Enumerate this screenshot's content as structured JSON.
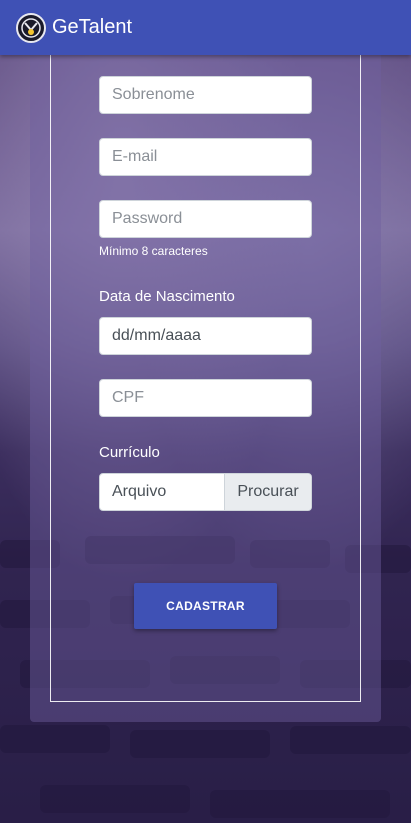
{
  "app": {
    "title": "GeTalent"
  },
  "form": {
    "surname_placeholder": "Sobrenome",
    "email_placeholder": "E-mail",
    "password_placeholder": "Password",
    "password_hint": "Mínimo 8 caracteres",
    "birthdate_label": "Data de Nascimento",
    "birthdate_placeholder": "dd/mm/aaaa",
    "cpf_placeholder": "CPF",
    "resume_label": "Currículo",
    "file_placeholder": "Arquivo",
    "browse_label": "Procurar",
    "submit_label": "CADASTRAR"
  },
  "colors": {
    "primary": "#3f51b5",
    "logo_accent": "#f3c531"
  },
  "icons": {
    "logo": "getalent-logo-icon"
  }
}
